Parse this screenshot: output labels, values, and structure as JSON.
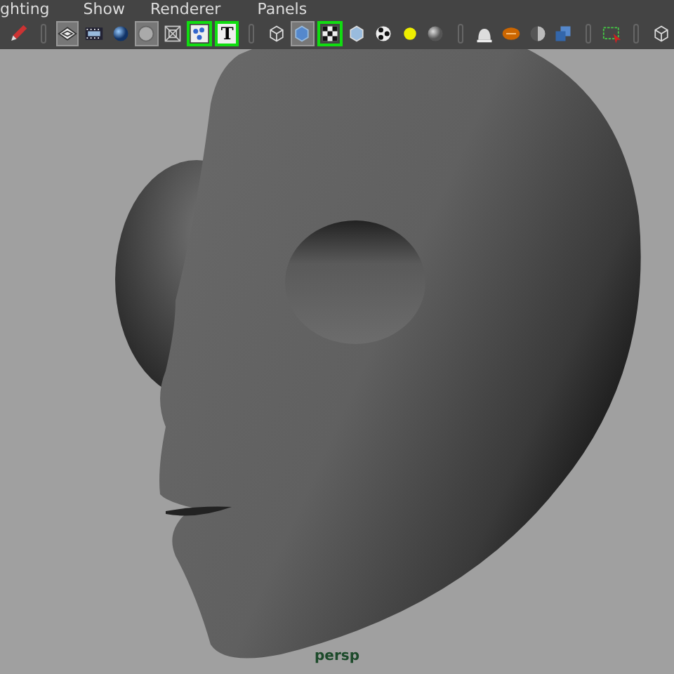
{
  "menu_bar": {
    "items": [
      "ghting",
      "Show",
      "Renderer",
      "Panels"
    ]
  },
  "toolbar": {
    "groups": [
      [
        {
          "selected": false,
          "on": false
        }
      ],
      [
        {
          "selected": true,
          "on": false
        },
        {
          "selected": false,
          "on": false
        },
        {
          "selected": false,
          "on": false
        },
        {
          "selected": true,
          "on": false
        },
        {
          "selected": false,
          "on": false
        },
        {
          "selected": false,
          "on": true
        },
        {
          "selected": false,
          "on": true,
          "label": "T"
        }
      ],
      [
        {
          "selected": false,
          "on": false
        },
        {
          "selected": true,
          "on": false
        },
        {
          "selected": false,
          "on": true
        },
        {
          "selected": false,
          "on": false
        },
        {
          "selected": false,
          "on": false
        },
        {
          "selected": false,
          "on": false
        },
        {
          "selected": false,
          "on": false
        }
      ],
      [
        {
          "selected": false,
          "on": false
        },
        {
          "selected": false,
          "on": false
        },
        {
          "selected": false,
          "on": false
        },
        {
          "selected": false,
          "on": false
        }
      ],
      [
        {
          "selected": false,
          "on": false
        }
      ],
      [
        {
          "selected": false,
          "on": false
        }
      ]
    ]
  },
  "viewport": {
    "camera_label": "persp"
  }
}
